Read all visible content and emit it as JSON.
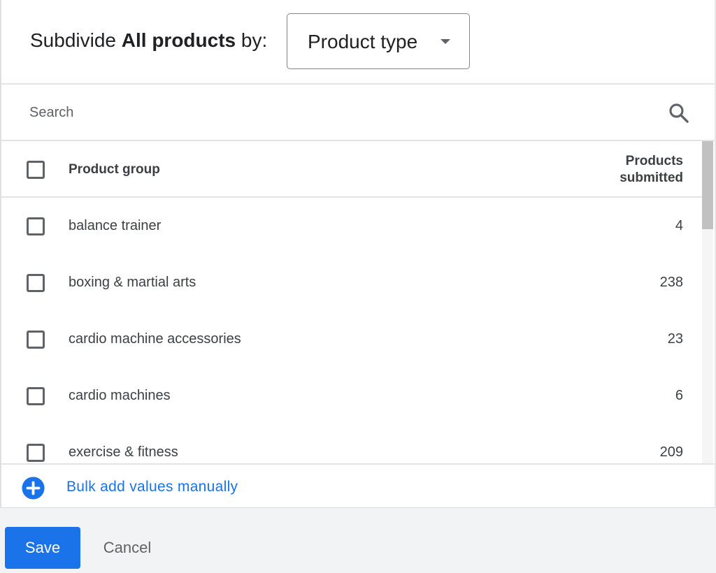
{
  "header": {
    "prefix": "Subdivide ",
    "subject": "All products",
    "suffix": " by:",
    "dropdown": {
      "selected": "Product type",
      "icon": "chevron-down-icon"
    }
  },
  "search": {
    "placeholder": "Search",
    "value": "",
    "icon": "search-icon"
  },
  "table": {
    "columns": {
      "group": "Product group",
      "count_line1": "Products",
      "count_line2": "submitted"
    },
    "rows": [
      {
        "label": "balance trainer",
        "count": "4",
        "checked": false
      },
      {
        "label": "boxing & martial arts",
        "count": "238",
        "checked": false
      },
      {
        "label": "cardio machine accessories",
        "count": "23",
        "checked": false
      },
      {
        "label": "cardio machines",
        "count": "6",
        "checked": false
      },
      {
        "label": "exercise & fitness",
        "count": "209",
        "checked": false
      }
    ]
  },
  "bulk_add": {
    "label": "Bulk add values manually",
    "icon": "add-circle-icon"
  },
  "footer": {
    "save_label": "Save",
    "cancel_label": "Cancel"
  },
  "colors": {
    "accent": "#1a73e8",
    "text": "#202124",
    "secondary_text": "#5f6368"
  }
}
